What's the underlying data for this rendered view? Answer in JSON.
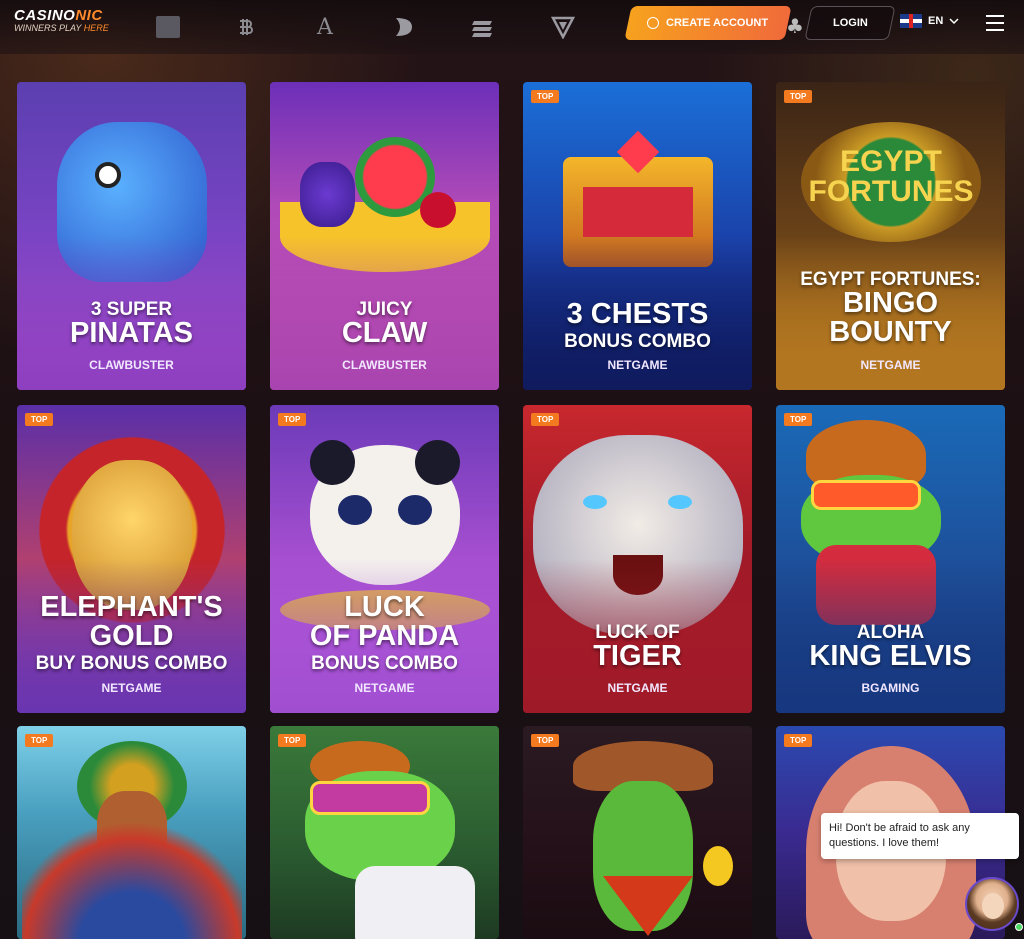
{
  "header": {
    "logo_main_a": "CASINO",
    "logo_main_b": "NIC",
    "logo_sub_a": "WINNERS PLAY ",
    "logo_sub_b": "HERE",
    "create_account_label": "CREATE ACCOUNT",
    "login_label": "LOGIN",
    "language": "EN",
    "nav_icons": [
      "square-icon",
      "bitcoin-icon",
      "letter-a-icon",
      "crescent-icon",
      "stripes-icon",
      "v-shield-icon"
    ]
  },
  "games": [
    {
      "top": false,
      "line1": "3 SUPER",
      "line2": "PINATAS",
      "line3": "",
      "provider": "CLAWBUSTER",
      "theme": "pinata"
    },
    {
      "top": false,
      "line1": "JUICY",
      "line2": "CLAW",
      "line3": "",
      "provider": "CLAWBUSTER",
      "theme": "fruit"
    },
    {
      "top": true,
      "line1": "3 CHESTS",
      "line2": "BONUS COMBO",
      "line3": "",
      "provider": "NETGAME",
      "theme": "chests"
    },
    {
      "top": true,
      "line1": "EGYPT FORTUNES:",
      "line2": "BINGO",
      "line3": "BOUNTY",
      "provider": "NETGAME",
      "theme": "egypt"
    },
    {
      "top": true,
      "line1": "ELEPHANT'S",
      "line2": "GOLD",
      "line3": "BUY BONUS COMBO",
      "provider": "NETGAME",
      "theme": "elephant"
    },
    {
      "top": true,
      "line1": "LUCK",
      "line2": "OF PANDA",
      "line3": "BONUS COMBO",
      "provider": "NETGAME",
      "theme": "panda"
    },
    {
      "top": true,
      "line1": "LUCK OF",
      "line2": "TIGER",
      "line3": "",
      "provider": "NETGAME",
      "theme": "tiger"
    },
    {
      "top": true,
      "line1": "ALOHA",
      "line2": "KING ELVIS",
      "line3": "",
      "provider": "BGAMING",
      "theme": "elvis"
    },
    {
      "top": true,
      "line1": "",
      "line2": "",
      "line3": "",
      "provider": "",
      "theme": "aztec"
    },
    {
      "top": true,
      "line1": "",
      "line2": "",
      "line3": "",
      "provider": "",
      "theme": "frog"
    },
    {
      "top": true,
      "line1": "",
      "line2": "",
      "line3": "",
      "provider": "",
      "theme": "cactus"
    },
    {
      "top": true,
      "line1": "",
      "line2": "",
      "line3": "",
      "provider": "",
      "theme": "goddess"
    }
  ],
  "top_badge_label": "TOP",
  "chat": {
    "message": "Hi! Don't be afraid to ask any questions. I love them!"
  }
}
